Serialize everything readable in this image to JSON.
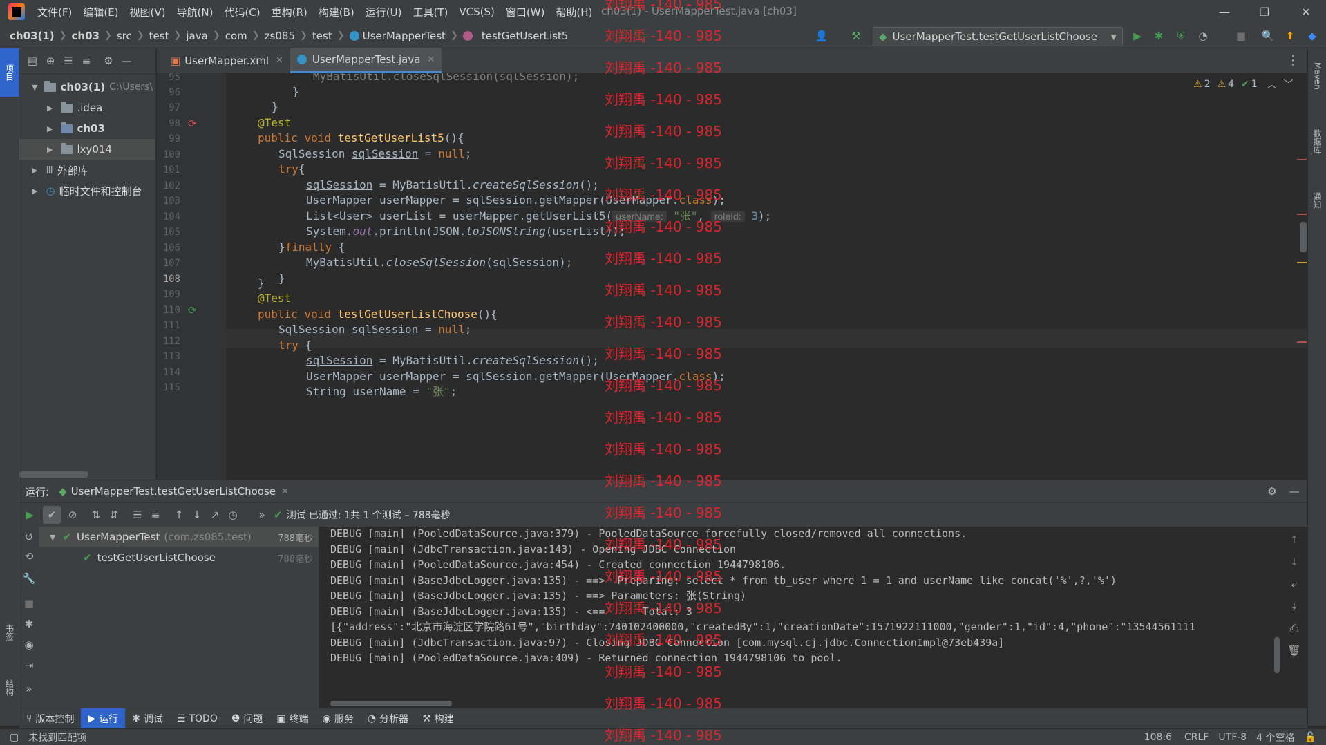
{
  "titlebar": {
    "menus": [
      "文件(F)",
      "编辑(E)",
      "视图(V)",
      "导航(N)",
      "代码(C)",
      "重构(R)",
      "构建(B)",
      "运行(U)",
      "工具(T)",
      "VCS(S)",
      "窗口(W)",
      "帮助(H)"
    ],
    "title": "ch03(1) - UserMapperTest.java [ch03]"
  },
  "breadcrumb": {
    "items": [
      "ch03(1)",
      "ch03",
      "src",
      "test",
      "java",
      "com",
      "zs085",
      "test",
      "UserMapperTest",
      "testGetUserList5"
    ]
  },
  "run_config": {
    "label": "UserMapperTest.testGetUserListChoose"
  },
  "left_stripe": {
    "project_label": "项目",
    "bookmarks_label": "书签",
    "structure_label": "结构"
  },
  "right_stripe": {
    "maven_label": "Maven",
    "database_label": "数据库",
    "notifications_label": "通知"
  },
  "project_tree": {
    "items": [
      {
        "label": "ch03(1)",
        "suffix": "C:\\Users\\"
      },
      {
        "label": ".idea"
      },
      {
        "label": "ch03"
      },
      {
        "label": "lxy014"
      },
      {
        "label": "外部库"
      },
      {
        "label": "临时文件和控制台"
      }
    ]
  },
  "tabs": [
    {
      "label": "UserMapper.xml"
    },
    {
      "label": "UserMapperTest.java"
    }
  ],
  "inspections": {
    "warn_a": "2",
    "warn_b": "4",
    "ok": "1"
  },
  "editor": {
    "line_numbers": [
      "95",
      "96",
      "97",
      "98",
      "99",
      "100",
      "101",
      "102",
      "103",
      "104",
      "105",
      "106",
      "107",
      "108",
      "109",
      "110",
      "111",
      "112",
      "113",
      "114",
      "115"
    ],
    "hints": {
      "userName": "userName:",
      "roleId": "roleId:"
    },
    "tokens": {
      "top_partial": "MyBatisUtil.closeSqlSession(sqlSession);",
      "test_anno": "@Test",
      "public": "public",
      "void": "void",
      "method1": "testGetUserList5",
      "method2": "testGetUserListChoose",
      "sqlsession_type": "SqlSession",
      "sqlSession": "sqlSession",
      "null": "null",
      "try": "try",
      "finally": "finally",
      "createSqlSession": "createSqlSession",
      "usermapper_decl": "UserMapper userMapper = ",
      "getmapper_mid": ".getMapper(UserMapper.",
      "class_kw": "class",
      "list_decl": "List<User> userList = userMapper.getUserList5(",
      "str_zhang": "\"张\"",
      "num_3": "3",
      "sysout_a": "System.",
      "out": "out",
      "println_a": ".println(JSON.",
      "toJSONString": "toJSONString",
      "println_b": "(userList));",
      "close_a": "MyBatisUtil.",
      "closeSqlSession": "closeSqlSession",
      "string_decl": "String userName = ",
      "mybatis_util": "MyBatisUtil."
    }
  },
  "run_panel": {
    "label": "运行:",
    "tab": "UserMapperTest.testGetUserListChoose",
    "status": "测试 已通过: 1共 1 个测试 – 788毫秒",
    "tree": [
      {
        "label": "UserMapperTest",
        "pkg": "(com.zs085.test)",
        "time": "788毫秒"
      },
      {
        "label": "testGetUserListChoose",
        "time": "788毫秒"
      }
    ],
    "console": [
      "DEBUG [main] (PooledDataSource.java:379) - PooledDataSource forcefully closed/removed all connections.",
      "DEBUG [main] (JdbcTransaction.java:143) - Opening JDBC Connection",
      "DEBUG [main] (PooledDataSource.java:454) - Created connection 1944798106.",
      "DEBUG [main] (BaseJdbcLogger.java:135) - ==>  Preparing: select * from tb_user where 1 = 1 and userName like concat('%',?,'%')",
      "DEBUG [main] (BaseJdbcLogger.java:135) - ==> Parameters: 张(String)",
      "DEBUG [main] (BaseJdbcLogger.java:135) - <==      Total: 3",
      "[{\"address\":\"北京市海淀区学院路61号\",\"birthday\":740102400000,\"createdBy\":1,\"creationDate\":1571922111000,\"gender\":1,\"id\":4,\"phone\":\"13544561111",
      "DEBUG [main] (JdbcTransaction.java:97) - Closing JDBC Connection [com.mysql.cj.jdbc.ConnectionImpl@73eb439a]",
      "DEBUG [main] (PooledDataSource.java:409) - Returned connection 1944798106 to pool."
    ]
  },
  "bottom_tools": [
    "版本控制",
    "运行",
    "调试",
    "TODO",
    "问题",
    "终端",
    "服务",
    "分析器",
    "构建"
  ],
  "statusbar": {
    "message": "未找到匹配项",
    "position": "108:6",
    "line_sep": "CRLF",
    "encoding": "UTF-8",
    "indent": "4 个空格"
  },
  "watermark": {
    "text": "刘翔禹 -140 - 985"
  }
}
